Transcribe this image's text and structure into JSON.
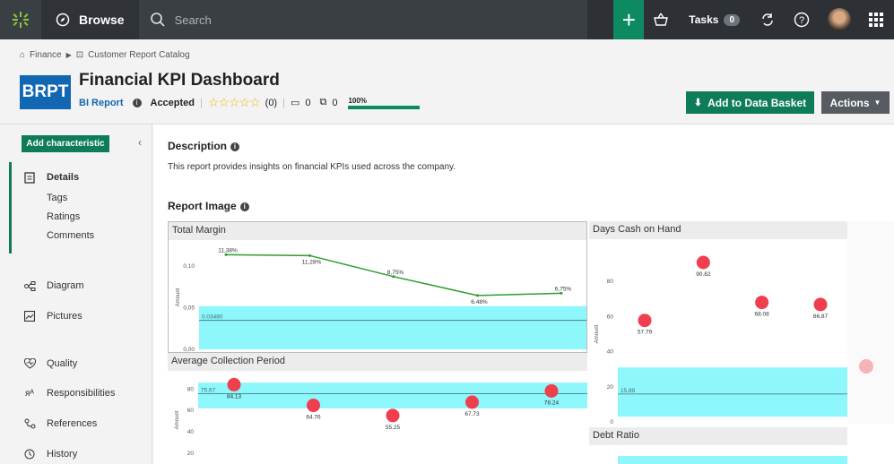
{
  "topbar": {
    "browse_label": "Browse",
    "search_placeholder": "Search",
    "tasks_label": "Tasks",
    "tasks_count": "0",
    "accent": "#0e8a63"
  },
  "breadcrumb": [
    "Finance",
    "Customer Report Catalog"
  ],
  "asset": {
    "logo_text": "BRPT",
    "title": "Financial KPI Dashboard",
    "type": "BI Report",
    "status": "Accepted",
    "stars": "☆☆☆☆☆",
    "rating_count": "(0)",
    "comments_count": "0",
    "tags_count": "0",
    "completeness": "100%",
    "completeness_value": 1.0
  },
  "buttons": {
    "add_to_basket": "Add to Data Basket",
    "actions": "Actions"
  },
  "sidebar": {
    "add_characteristic": "Add characteristic",
    "details": "Details",
    "sub_items": [
      "Tags",
      "Ratings",
      "Comments"
    ],
    "items": [
      {
        "label": "Diagram",
        "icon": "diagram-icon"
      },
      {
        "label": "Pictures",
        "icon": "pictures-icon"
      },
      {
        "label": "Quality",
        "icon": "quality-icon"
      },
      {
        "label": "Responsibilities",
        "icon": "responsibilities-icon"
      },
      {
        "label": "References",
        "icon": "references-icon"
      },
      {
        "label": "History",
        "icon": "history-icon"
      }
    ]
  },
  "main": {
    "description_heading": "Description",
    "description_text": "This report provides insights on financial KPIs used across the company.",
    "report_image_heading": "Report Image"
  },
  "chart_data": [
    {
      "type": "line",
      "title": "Total Margin",
      "ylabel": "Amount",
      "x": [
        1,
        2,
        3,
        4,
        5
      ],
      "values": [
        0.1138,
        0.1128,
        0.0875,
        0.0648,
        0.0675
      ],
      "data_labels": [
        "11,38%",
        "11,28%",
        "8,75%",
        "6,48%",
        "6,75%"
      ],
      "ylim": [
        0,
        0.125
      ],
      "ticks": [
        "0,00",
        "0,05",
        "0,10"
      ],
      "band": [
        0,
        0.052
      ],
      "reference_label": "0.03480",
      "reference_value": 0.0348
    },
    {
      "type": "scatter",
      "title": "Days Cash on Hand",
      "ylabel": "Amount",
      "values": [
        57.79,
        90.82,
        68.08,
        66.87
      ],
      "data_labels": [
        "57.79",
        "90.82",
        "68.08",
        "66.87"
      ],
      "ylim": [
        0,
        100
      ],
      "ticks": [
        "0",
        "20",
        "40",
        "60",
        "80"
      ],
      "band": [
        3,
        31
      ],
      "reference_label": "15.89",
      "reference_value": 15.89
    },
    {
      "type": "scatter",
      "title": "Average Collection Period",
      "ylabel": "Amount",
      "values": [
        84.13,
        64.76,
        55.25,
        67.73,
        78.24
      ],
      "data_labels": [
        "84.13",
        "64.76",
        "55.25",
        "67.73",
        "78.24"
      ],
      "ylim": [
        10,
        92
      ],
      "ticks": [
        "20",
        "40",
        "60",
        "80"
      ],
      "band": [
        62,
        86
      ],
      "reference_label": "75.67",
      "reference_value": 75.67
    },
    {
      "type": "scatter",
      "title": "Debt Ratio"
    }
  ]
}
